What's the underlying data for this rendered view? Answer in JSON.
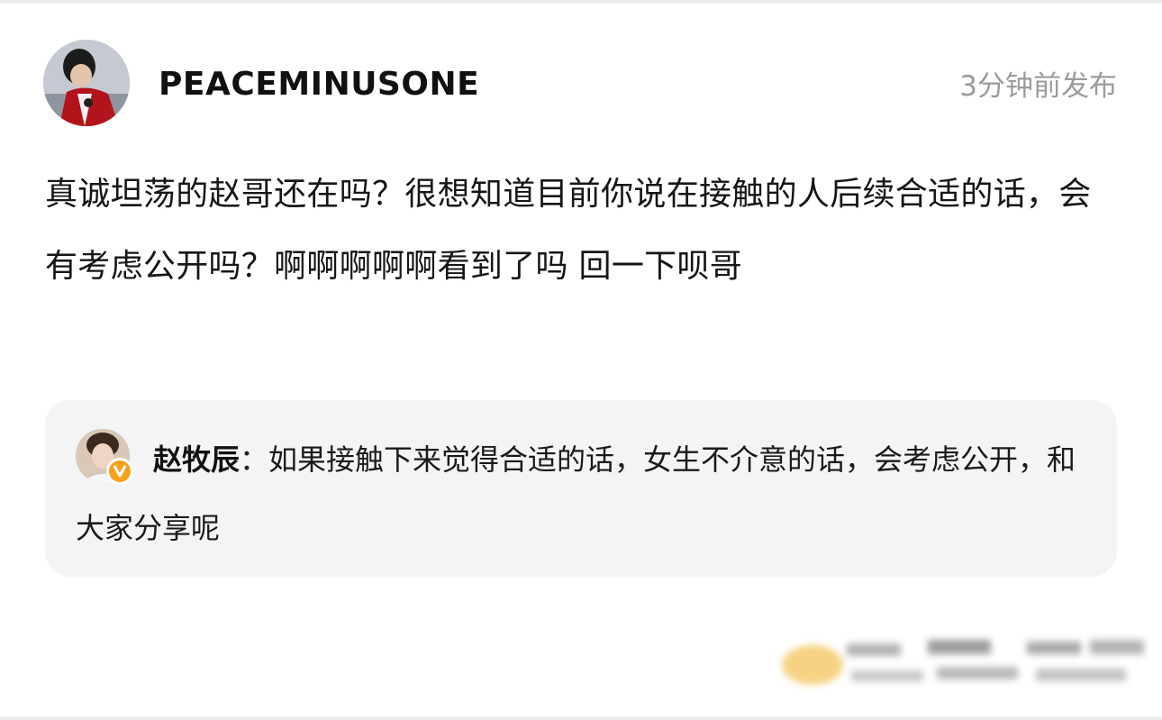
{
  "post": {
    "username": "PEACEMINUSONE",
    "timestamp": "3分钟前发布",
    "text": "真诚坦荡的赵哥还在吗？很想知道目前你说在接触的人后续合适的话，会有考虑公开吗？啊啊啊啊啊看到了吗 回一下呗哥"
  },
  "reply": {
    "author": "赵牧辰",
    "separator": "：",
    "text": "如果接触下来觉得合适的话，女生不介意的话，会考虑公开，和大家分享呢"
  },
  "colors": {
    "background": "#ffffff",
    "reply_background": "#f4f4f4",
    "timestamp": "#9b9b9b",
    "verified_badge": "#f6a21a"
  },
  "icons": {
    "verified_badge": "verified-v-icon"
  }
}
